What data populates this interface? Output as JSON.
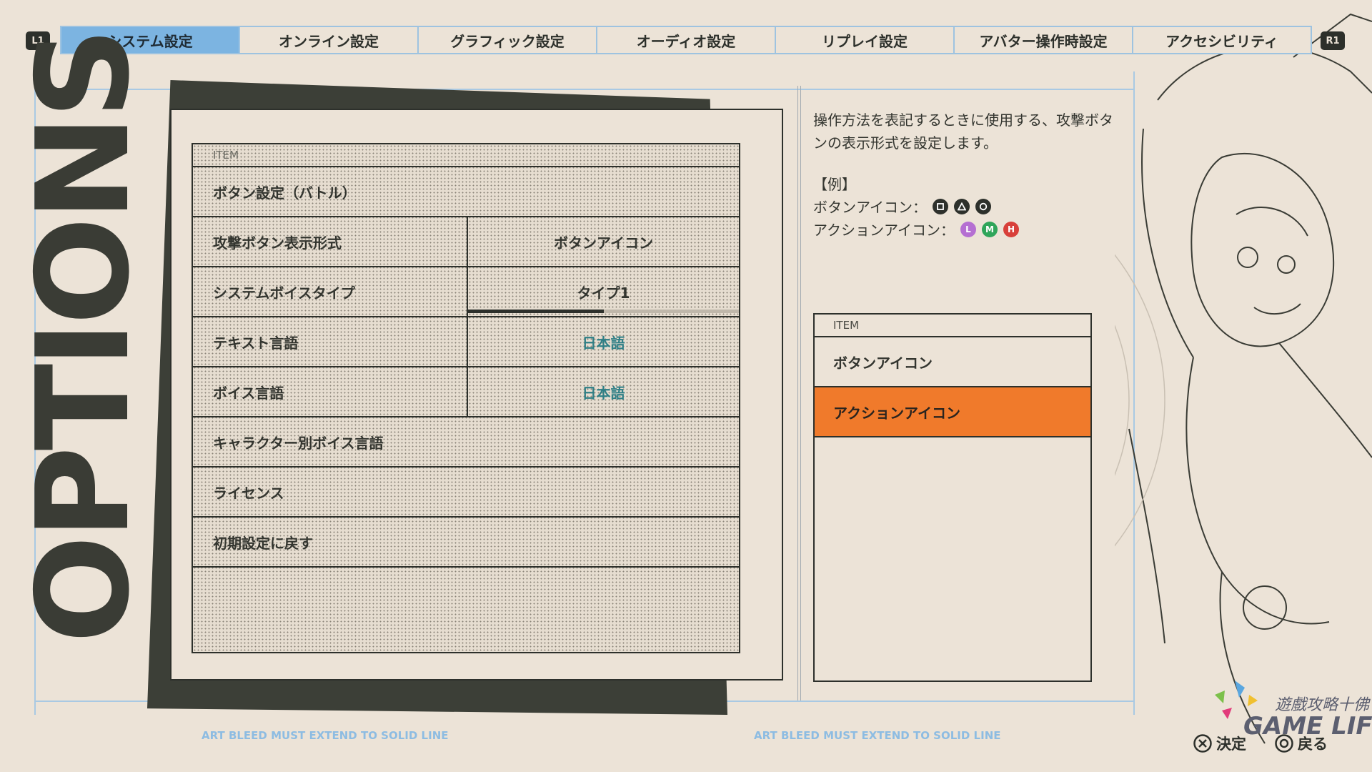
{
  "tabs": {
    "left_shoulder": "L1",
    "right_shoulder": "R1",
    "items": [
      {
        "label": "システム設定"
      },
      {
        "label": "オンライン設定"
      },
      {
        "label": "グラフィック設定"
      },
      {
        "label": "オーディオ設定"
      },
      {
        "label": "リプレイ設定"
      },
      {
        "label": "アバター操作時設定"
      },
      {
        "label": "アクセシビリティ"
      }
    ],
    "active_index": 0
  },
  "title": "OPTIONS",
  "settings": {
    "header": "ITEM",
    "rows": [
      {
        "label": "ボタン設定（バトル）",
        "value": ""
      },
      {
        "label": "攻撃ボタン表示形式",
        "value": "ボタンアイコン"
      },
      {
        "label": "システムボイスタイプ",
        "value": "タイプ1",
        "slider_fraction": 0.5
      },
      {
        "label": "テキスト言語",
        "value": "日本語"
      },
      {
        "label": "ボイス言語",
        "value": "日本語"
      },
      {
        "label": "キャラクター別ボイス言語",
        "value": ""
      },
      {
        "label": "ライセンス",
        "value": ""
      },
      {
        "label": "初期設定に戻す",
        "value": ""
      }
    ]
  },
  "description": {
    "text": "操作方法を表記するときに使用する、攻撃ボタンの表示形式を設定します。",
    "example_heading": "【例】",
    "button_icon_label": "ボタンアイコン：",
    "action_icon_label": "アクションアイコン：",
    "action_icons": [
      {
        "letter": "L",
        "color": "#b56fd2"
      },
      {
        "letter": "M",
        "color": "#2fa55a"
      },
      {
        "letter": "H",
        "color": "#d8403a"
      }
    ]
  },
  "options_list": {
    "header": "ITEM",
    "items": [
      {
        "label": "ボタンアイコン"
      },
      {
        "label": "アクションアイコン"
      }
    ],
    "selected_index": 1
  },
  "bleed_note_left": "ART BLEED MUST EXTEND TO SOLID LINE",
  "bleed_note_right": "ART BLEED MUST EXTEND TO SOLID LINE",
  "footer": {
    "confirm_label": "決定",
    "back_label": "戻る"
  },
  "watermark": {
    "line1": "遊戲攻略十佛",
    "line2": "GAME LIF"
  },
  "colors": {
    "active_tab": "#7cb4e1",
    "selected_option": "#f07a2b",
    "teal_value": "#2f7f86",
    "background": "#ece3d7"
  }
}
